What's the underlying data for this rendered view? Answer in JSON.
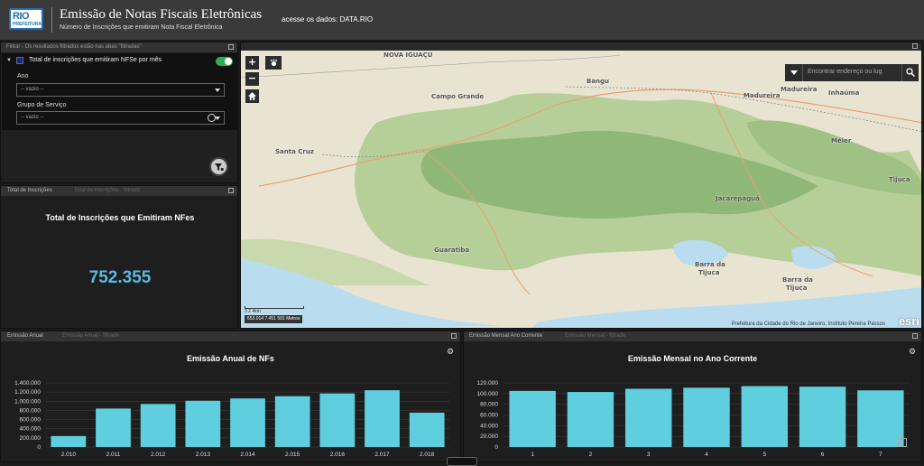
{
  "header": {
    "logo_top": "RIO",
    "logo_bottom": "PREFEITURA",
    "title": "Emissão de Notas Fiscais Eletrônicas",
    "subtitle": "Número de Inscrições que emitiram Nota Fiscal Eletrônica",
    "data_link": "acesse os dados: DATA.RIO"
  },
  "filter": {
    "panel_title": "Filtrar - Os resultados filtrados estão nas abas \"filtradas\"",
    "layer_label": "Total de inscrições que emitiram NFSe por mês",
    "toggle_on": true,
    "year_label": "Ano",
    "year_value": "-- vazio --",
    "service_label": "Grupo de Serviço",
    "service_value": "-- vazio --"
  },
  "total": {
    "tab_active": "Total de Inscrições",
    "tab_inactive": "Total de Inscrições - filtrado",
    "title": "Total de Inscrições que Emitiram NFes",
    "value": "752.355"
  },
  "map": {
    "search_placeholder": "Encontrar endereço ou lug",
    "labels": [
      "NOVA IGUAÇU",
      "Bangu",
      "Campo Grande",
      "Madureira",
      "Madureira",
      "Inhaúma",
      "Santa Cruz",
      "Méier",
      "Tijuca",
      "Jacarepaguá",
      "Guaratiba",
      "Barra da",
      "Tijuca",
      "Barra da",
      "Tijuca"
    ],
    "scale_text": "0   2   4km",
    "coords": "653.014 7.451 591 Metros",
    "attribution": "Prefeitura da Cidade do Rio de Janeiro, Instituto Pereira Passos",
    "esri": "esri",
    "zoom_in": "+",
    "zoom_out": "−"
  },
  "annual": {
    "tab_active": "Emissão Anual",
    "tab_inactive": "Emissão Anual - filtrado",
    "title": "Emissão Anual de NFs"
  },
  "monthly": {
    "tab_active": "Emissão Mensal Ano Corrente",
    "tab_inactive": "Emissão Mensal - filtrado",
    "title": "Emissão Mensal no Ano Corrente"
  },
  "colors": {
    "bar": "#5fcfe0",
    "accent": "#5bb8e0",
    "toggle": "#2fae5a"
  },
  "chart_data": [
    {
      "type": "bar",
      "title": "Emissão Anual de NFs",
      "categories": [
        "2.010",
        "2.011",
        "2.012",
        "2.013",
        "2.014",
        "2.015",
        "2.016",
        "2.017",
        "2.018"
      ],
      "values": [
        240000,
        840000,
        940000,
        1010000,
        1060000,
        1110000,
        1170000,
        1240000,
        750000
      ],
      "ylim": [
        0,
        1400000
      ],
      "yticks": [
        "1.400.000",
        "1.200.000",
        "1.000.000",
        "800.000",
        "600.000",
        "400.000",
        "200.000",
        "0"
      ],
      "grid": true
    },
    {
      "type": "bar",
      "title": "Emissão Mensal no Ano Corrente",
      "categories": [
        "1",
        "2",
        "3",
        "4",
        "5",
        "6",
        "7"
      ],
      "values": [
        105000,
        103000,
        109000,
        111000,
        114000,
        113000,
        106000
      ],
      "ylim": [
        0,
        120000
      ],
      "yticks": [
        "120.000",
        "100.000",
        "80.000",
        "60.000",
        "40.000",
        "20.000",
        "0"
      ],
      "grid": true
    }
  ]
}
